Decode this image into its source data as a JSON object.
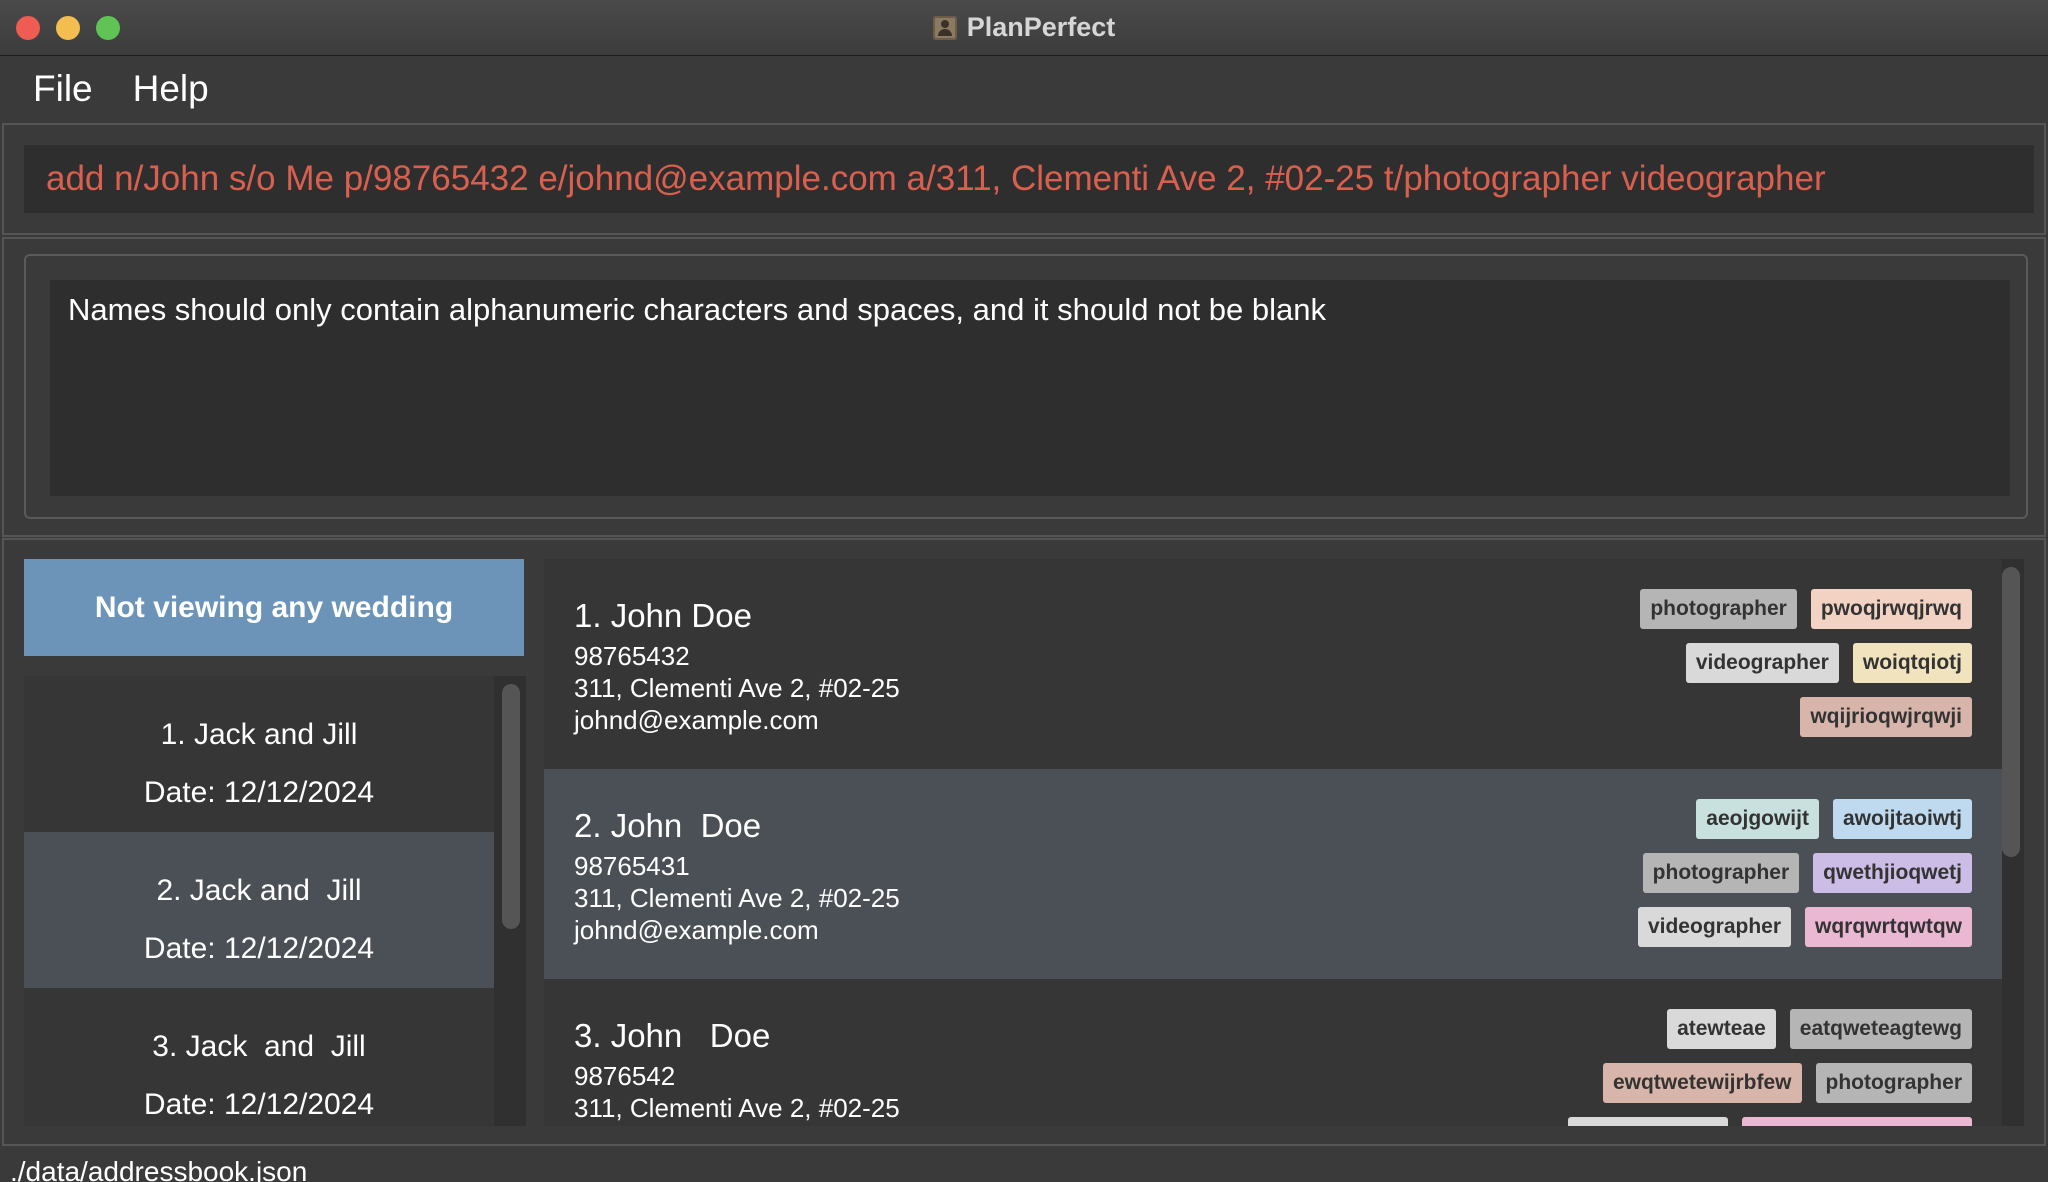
{
  "window": {
    "title": "PlanPerfect"
  },
  "menu": {
    "file": "File",
    "help": "Help"
  },
  "command_box": {
    "value": "add n/John s/o Me p/98765432 e/johnd@example.com a/311, Clementi Ave 2, #02-25 t/photographer videographer"
  },
  "result_display": {
    "text": "Names should only contain alphanumeric characters and spaces, and it should not be blank"
  },
  "wedding_banner": {
    "text": "Not viewing any wedding"
  },
  "weddings": [
    {
      "title": "1. Jack and Jill",
      "date": "Date: 12/12/2024"
    },
    {
      "title": "2. Jack and  Jill",
      "date": "Date: 12/12/2024"
    },
    {
      "title": "3. Jack  and  Jill",
      "date": "Date: 12/12/2024"
    }
  ],
  "persons": [
    {
      "name": "1. John Doe",
      "phone": "98765432",
      "address": "311, Clementi Ave 2, #02-25",
      "email": "johnd@example.com",
      "tags": [
        {
          "label": "photographer",
          "color": "#b5b5b5"
        },
        {
          "label": "pwoqjrwqjrwq",
          "color": "#f2d3c3"
        },
        {
          "label": "videographer",
          "color": "#d9d9d9"
        },
        {
          "label": "woiqtqiotj",
          "color": "#f1e3bd"
        },
        {
          "label": "wqijrioqwjrqwji",
          "color": "#d8b5aa"
        }
      ]
    },
    {
      "name": "2. John  Doe",
      "phone": "98765431",
      "address": "311, Clementi Ave 2, #02-25",
      "email": "johnd@example.com",
      "tags": [
        {
          "label": "aeojgowijt",
          "color": "#c8e0de"
        },
        {
          "label": "awoijtaoiwtj",
          "color": "#bfd9ee"
        },
        {
          "label": "photographer",
          "color": "#b5b5b5"
        },
        {
          "label": "qwethjioqwetj",
          "color": "#cbbde6"
        },
        {
          "label": "videographer",
          "color": "#d9d9d9"
        },
        {
          "label": "wqrqwrtqwtqw",
          "color": "#eab8d3"
        }
      ]
    },
    {
      "name": "3. John   Doe",
      "phone": "9876542",
      "address": "311, Clementi Ave 2, #02-25",
      "email": "",
      "tags": [
        {
          "label": "atewteae",
          "color": "#d9d9d9"
        },
        {
          "label": "eatqweteagtewg",
          "color": "#b5b5b5"
        },
        {
          "label": "ewqtwetewijrbfew",
          "color": "#d8b5aa"
        },
        {
          "label": "photographer",
          "color": "#b5b5b5"
        },
        {
          "label": "",
          "color": "#d9d9d9"
        },
        {
          "label": "",
          "color": "#eab8d3"
        }
      ]
    }
  ],
  "status_bar": {
    "path": "./data/addressbook.json"
  }
}
